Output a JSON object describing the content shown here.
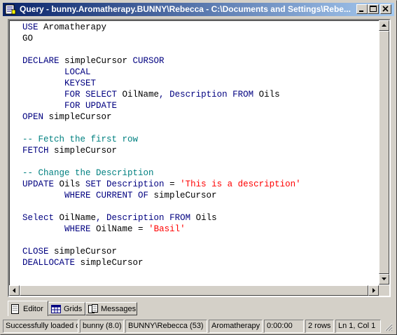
{
  "window": {
    "title": "Query - bunny.Aromatherapy.BUNNY\\Rebecca - C:\\Documents and Settings\\Rebe...",
    "title_gradient": [
      "#0a246a",
      "#a6caf0"
    ]
  },
  "editor": {
    "lines": [
      [
        {
          "t": "USE ",
          "c": "kw"
        },
        {
          "t": "Aromatherapy",
          "c": "id"
        }
      ],
      [
        {
          "t": "GO",
          "c": "id"
        }
      ],
      [],
      [
        {
          "t": "DECLARE ",
          "c": "kw"
        },
        {
          "t": "simpleCursor ",
          "c": "id"
        },
        {
          "t": "CURSOR",
          "c": "kw"
        }
      ],
      [
        {
          "t": "        LOCAL",
          "c": "kw"
        }
      ],
      [
        {
          "t": "        KEYSET",
          "c": "kw"
        }
      ],
      [
        {
          "t": "        FOR SELECT ",
          "c": "kw"
        },
        {
          "t": "OilName",
          "c": "id"
        },
        {
          "t": ", ",
          "c": "kw"
        },
        {
          "t": "Description ",
          "c": "kw"
        },
        {
          "t": "FROM ",
          "c": "kw"
        },
        {
          "t": "Oils",
          "c": "id"
        }
      ],
      [
        {
          "t": "        FOR UPDATE",
          "c": "kw"
        }
      ],
      [
        {
          "t": "OPEN ",
          "c": "kw"
        },
        {
          "t": "simpleCursor",
          "c": "id"
        }
      ],
      [],
      [
        {
          "t": "-- Fetch the first row",
          "c": "cmt"
        }
      ],
      [
        {
          "t": "FETCH ",
          "c": "kw"
        },
        {
          "t": "simpleCursor",
          "c": "id"
        }
      ],
      [],
      [
        {
          "t": "-- Change the Description",
          "c": "cmt"
        }
      ],
      [
        {
          "t": "UPDATE ",
          "c": "kw"
        },
        {
          "t": "Oils ",
          "c": "id"
        },
        {
          "t": "SET ",
          "c": "kw"
        },
        {
          "t": "Description ",
          "c": "kw"
        },
        {
          "t": "= ",
          "c": "id"
        },
        {
          "t": "'This is a description'",
          "c": "str"
        }
      ],
      [
        {
          "t": "        WHERE CURRENT OF ",
          "c": "kw"
        },
        {
          "t": "simpleCursor",
          "c": "id"
        }
      ],
      [],
      [
        {
          "t": "Select ",
          "c": "kw"
        },
        {
          "t": "OilName",
          "c": "id"
        },
        {
          "t": ", ",
          "c": "kw"
        },
        {
          "t": "Description ",
          "c": "kw"
        },
        {
          "t": "FROM ",
          "c": "kw"
        },
        {
          "t": "Oils",
          "c": "id"
        }
      ],
      [
        {
          "t": "        WHERE ",
          "c": "kw"
        },
        {
          "t": "OilName ",
          "c": "id"
        },
        {
          "t": "= ",
          "c": "id"
        },
        {
          "t": "'Basil'",
          "c": "str"
        }
      ],
      [],
      [
        {
          "t": "CLOSE ",
          "c": "kw"
        },
        {
          "t": "simpleCursor",
          "c": "id"
        }
      ],
      [
        {
          "t": "DEALLOCATE ",
          "c": "kw"
        },
        {
          "t": "simpleCursor",
          "c": "id"
        }
      ]
    ],
    "colors": {
      "kw": "#000080",
      "str": "#ff0000",
      "cmt": "#008080",
      "id": "#000000"
    }
  },
  "tabs": [
    {
      "label": "Editor",
      "icon": "editor-icon",
      "active": true
    },
    {
      "label": "Grids",
      "icon": "grid-icon",
      "active": false
    },
    {
      "label": "Messages",
      "icon": "messages-icon",
      "active": false
    }
  ],
  "status": {
    "message": "Successfully loaded q",
    "server": "bunny (8.0)",
    "user": "BUNNY\\Rebecca (53)",
    "database": "Aromatherapy",
    "time": "0:00:00",
    "rows": "2 rows",
    "position": "Ln 1, Col 1"
  }
}
